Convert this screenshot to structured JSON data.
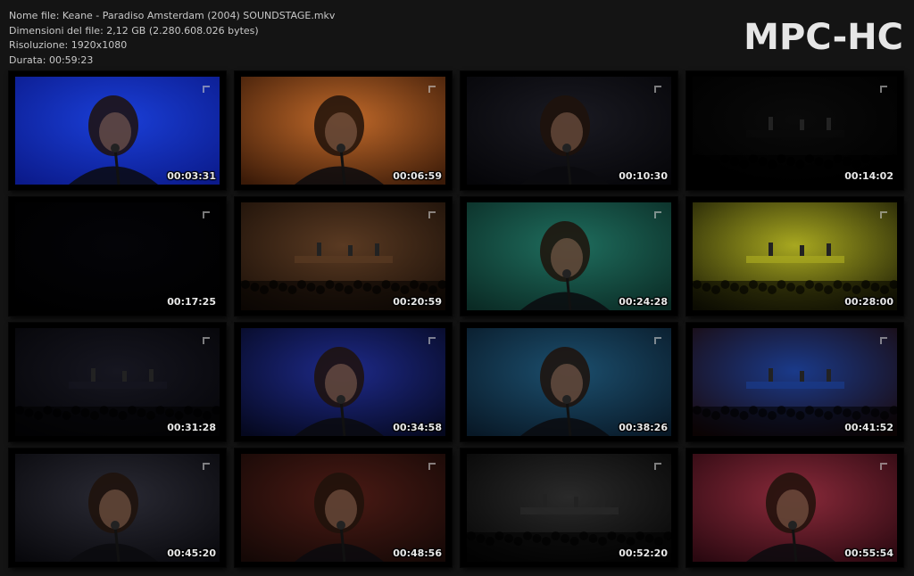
{
  "file_info": {
    "name_line": "Nome file: Keane - Paradiso Amsterdam (2004) SOUNDSTAGE.mkv",
    "size_line": "Dimensioni del file: 2,12 GB (2.280.608.026 bytes)",
    "resolution_line": "Risoluzione: 1920x1080",
    "duration_line": "Durata: 00:59:23"
  },
  "logo": "MPC-HC",
  "thumbnails": [
    {
      "time": "00:03:31",
      "scene": "singer-closeup-blue",
      "colors": [
        "#1a3fd8",
        "#0b1a8a"
      ]
    },
    {
      "time": "00:06:59",
      "scene": "singer-closeup-warm",
      "colors": [
        "#c26a2a",
        "#3a1a08"
      ]
    },
    {
      "time": "00:10:30",
      "scene": "singer-front-dark",
      "colors": [
        "#1a1a22",
        "#050508"
      ]
    },
    {
      "time": "00:14:02",
      "scene": "stage-dark-figures",
      "colors": [
        "#0a0a0a",
        "#000000"
      ]
    },
    {
      "time": "00:17:25",
      "scene": "black-frame",
      "colors": [
        "#040408",
        "#000000"
      ]
    },
    {
      "time": "00:20:59",
      "scene": "hall-crowd-keyboard",
      "colors": [
        "#5a3a22",
        "#1a0f08"
      ]
    },
    {
      "time": "00:24:28",
      "scene": "singer-green-stage",
      "colors": [
        "#1f6e5e",
        "#0a2a24"
      ]
    },
    {
      "time": "00:28:00",
      "scene": "stage-yellow-lights",
      "colors": [
        "#a8a820",
        "#1a1a05"
      ]
    },
    {
      "time": "00:31:28",
      "scene": "dark-hall-crowd",
      "colors": [
        "#161620",
        "#050508"
      ]
    },
    {
      "time": "00:34:58",
      "scene": "singer-blue-profile",
      "colors": [
        "#1e2a8a",
        "#05081e"
      ]
    },
    {
      "time": "00:38:26",
      "scene": "singer-closeup-teal",
      "colors": [
        "#1c4f6e",
        "#081826"
      ]
    },
    {
      "time": "00:41:52",
      "scene": "hall-blue-stage",
      "colors": [
        "#1a3a8a",
        "#1a0808"
      ]
    },
    {
      "time": "00:45:20",
      "scene": "singer-closeup-dark",
      "colors": [
        "#2a2a34",
        "#08080c"
      ]
    },
    {
      "time": "00:48:56",
      "scene": "singer-red-stage",
      "colors": [
        "#4a1a14",
        "#140806"
      ]
    },
    {
      "time": "00:52:20",
      "scene": "stage-band-wide",
      "colors": [
        "#2a2a2a",
        "#050505"
      ]
    },
    {
      "time": "00:55:54",
      "scene": "singer-pink-light",
      "colors": [
        "#8a2a3a",
        "#2a0810"
      ]
    }
  ]
}
